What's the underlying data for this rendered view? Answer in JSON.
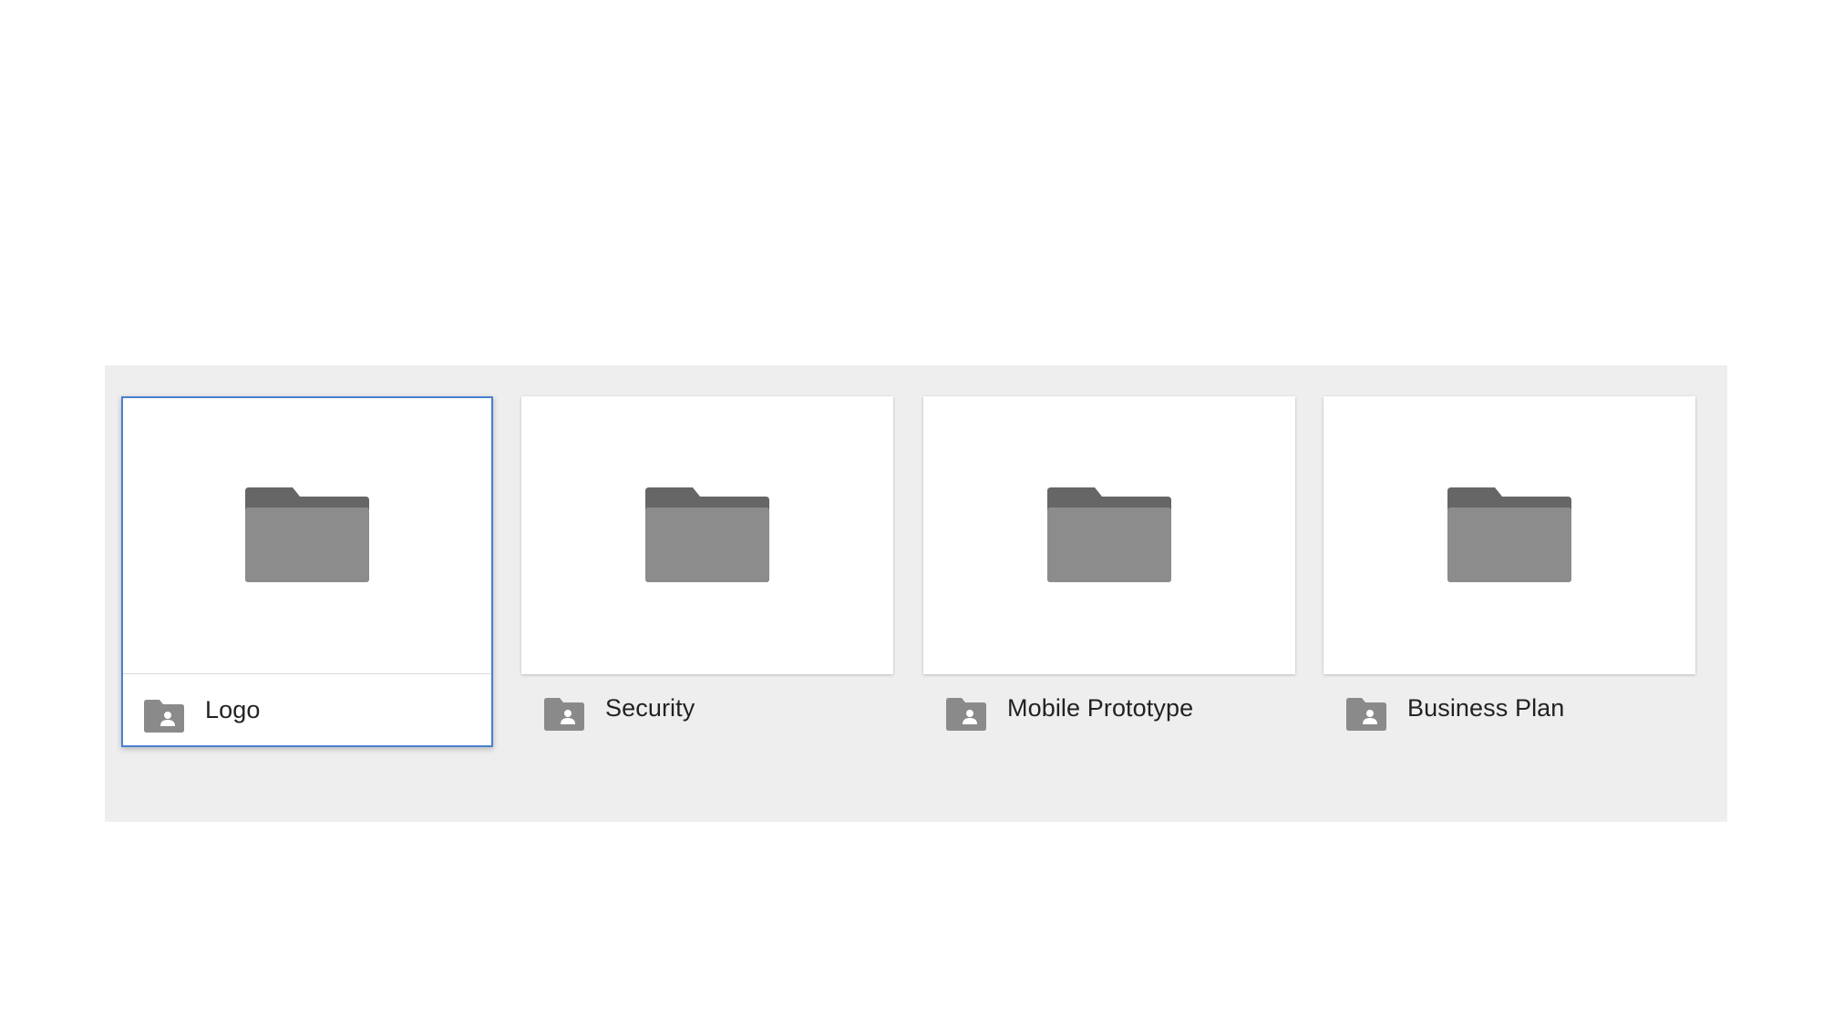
{
  "folders": [
    {
      "name": "Logo",
      "selected": true,
      "icon": "shared-folder-icon",
      "preview_icon": "folder-icon"
    },
    {
      "name": "Security",
      "selected": false,
      "icon": "shared-folder-icon",
      "preview_icon": "folder-icon"
    },
    {
      "name": "Mobile Prototype",
      "selected": false,
      "icon": "shared-folder-icon",
      "preview_icon": "folder-icon"
    },
    {
      "name": "Business Plan",
      "selected": false,
      "icon": "shared-folder-icon",
      "preview_icon": "folder-icon"
    }
  ],
  "colors": {
    "panel_background": "#eeeeee",
    "card_background": "#ffffff",
    "selection_border": "#4a7fd0",
    "folder_front": "#8c8c8c",
    "folder_back": "#666666",
    "label_text": "#222222"
  }
}
